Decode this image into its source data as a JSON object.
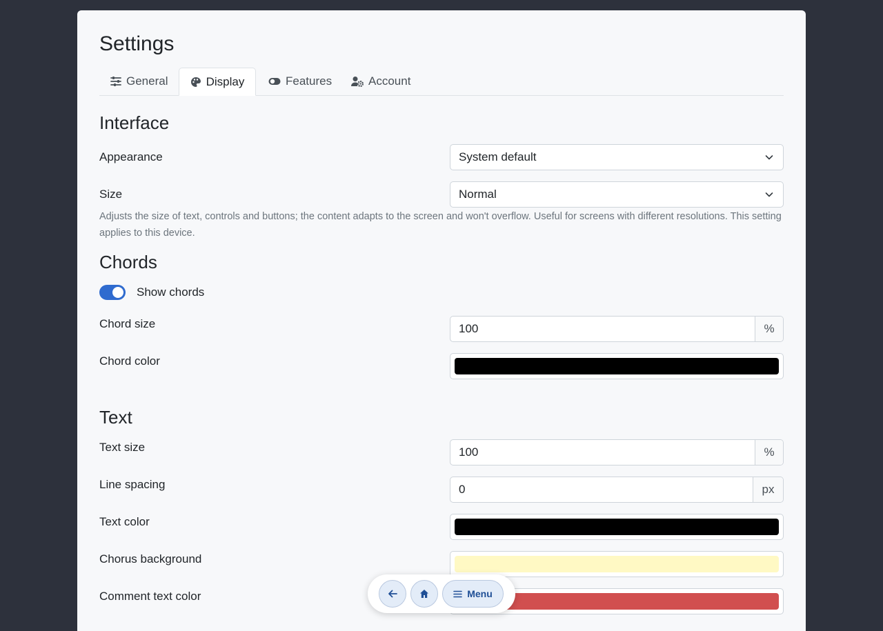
{
  "page": {
    "title": "Settings"
  },
  "tabs": [
    {
      "label": "General",
      "icon": "sliders-icon"
    },
    {
      "label": "Display",
      "icon": "palette-icon",
      "active": true
    },
    {
      "label": "Features",
      "icon": "toggle-icon"
    },
    {
      "label": "Account",
      "icon": "user-gear-icon"
    }
  ],
  "interface": {
    "title": "Interface",
    "appearance": {
      "label": "Appearance",
      "value": "System default"
    },
    "size": {
      "label": "Size",
      "value": "Normal",
      "help": "Adjusts the size of text, controls and buttons; the content adapts to the screen and won't overflow. Useful for screens with different resolutions. This setting applies to this device."
    }
  },
  "chords": {
    "title": "Chords",
    "show_chords": {
      "label": "Show chords",
      "on": true
    },
    "chord_size": {
      "label": "Chord size",
      "value": "100",
      "unit": "%"
    },
    "chord_color": {
      "label": "Chord color",
      "color": "#000000"
    }
  },
  "text": {
    "title": "Text",
    "text_size": {
      "label": "Text size",
      "value": "100",
      "unit": "%"
    },
    "line_spacing": {
      "label": "Line spacing",
      "value": "0",
      "unit": "px"
    },
    "text_color": {
      "label": "Text color",
      "color": "#000000"
    },
    "chorus_background": {
      "label": "Chorus background",
      "color": "#fff9c4"
    },
    "comment_text_color": {
      "label": "Comment text color",
      "color": "#d14f4f"
    }
  },
  "floatbar": {
    "menu_label": "Menu"
  },
  "colors": {
    "accent": "#2f6bcf",
    "button_bg": "#e3ecf8",
    "button_text": "#1f4f96"
  }
}
